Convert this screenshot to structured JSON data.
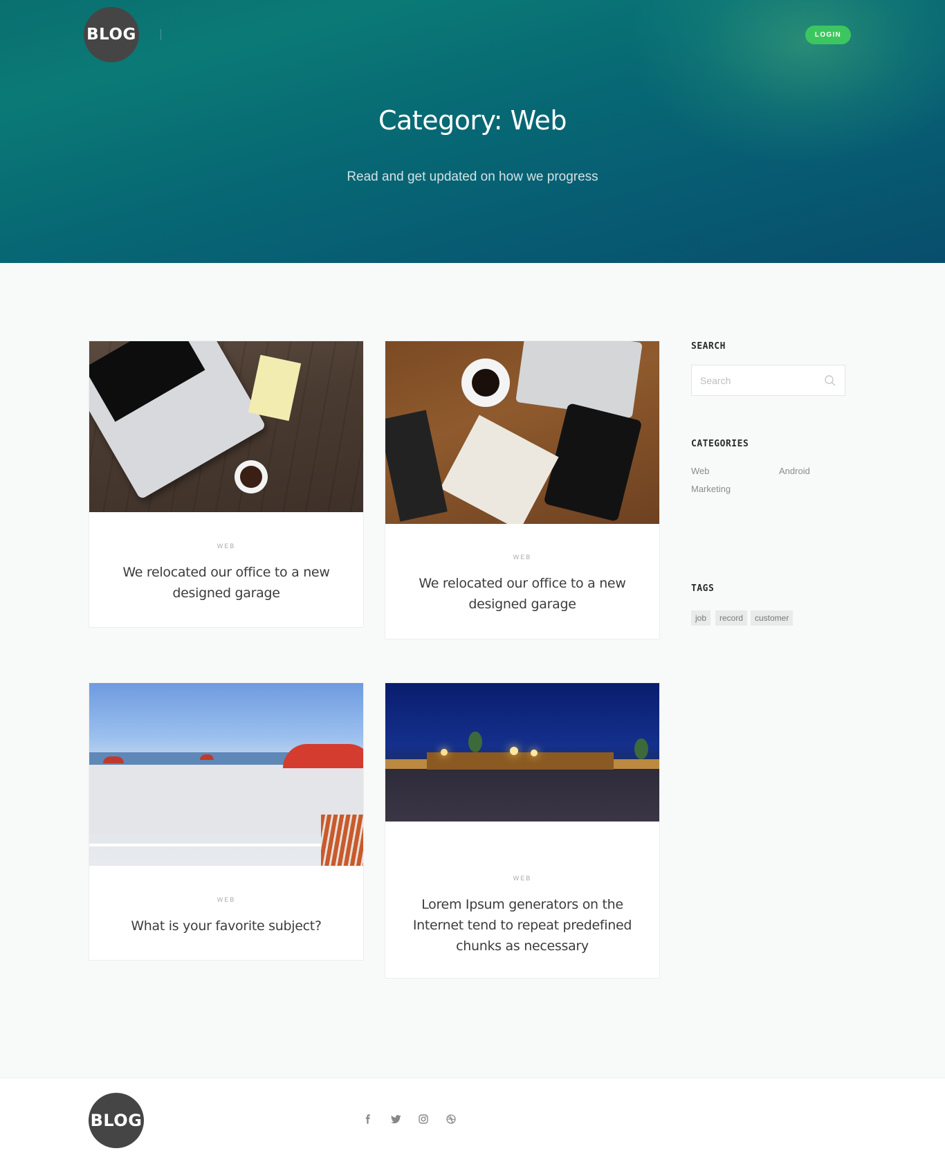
{
  "header": {
    "logo_text": "BLOG",
    "login_label": "LOGIN",
    "title": "Category: Web",
    "subtitle": "Read and get updated on how we progress"
  },
  "posts": [
    {
      "category": "WEB",
      "title": "We relocated our office to a new designed garage"
    },
    {
      "category": "WEB",
      "title": "We relocated our office to a new designed garage"
    },
    {
      "category": "WEB",
      "title": "What is your favorite subject?"
    },
    {
      "category": "WEB",
      "title": "Lorem Ipsum generators on the Internet tend to repeat predefined chunks as necessary"
    }
  ],
  "sidebar": {
    "search_heading": "SEARCH",
    "search_placeholder": "Search",
    "categories_heading": "CATEGORIES",
    "categories": [
      "Web",
      "Android",
      "Marketing"
    ],
    "tags_heading": "TAGS",
    "tags": [
      "job",
      "record",
      "customer"
    ]
  },
  "footer": {
    "logo_text": "BLOG",
    "social": [
      "facebook-icon",
      "twitter-icon",
      "instagram-icon",
      "dribbble-icon"
    ]
  },
  "colors": {
    "login_button": "#3cc65f",
    "hero_gradient_start": "#0a6f70",
    "hero_gradient_end": "#084e6c",
    "logo_bg": "#454545"
  }
}
